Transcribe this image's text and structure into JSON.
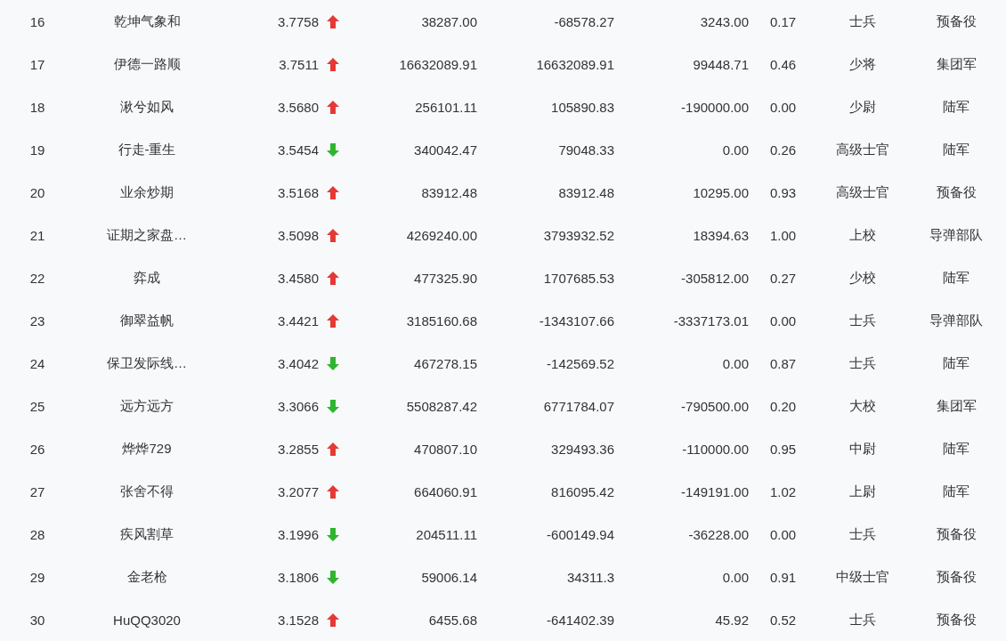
{
  "rows": [
    {
      "rank": "16",
      "name": "乾坤气象和",
      "score": "3.7758",
      "kind": "up",
      "column_4": "38287.00",
      "column_5": "-68578.27",
      "column_6": "3243.00",
      "column_7": "0.17",
      "rank_title": "士兵",
      "unit": "预备役"
    },
    {
      "rank": "17",
      "name": "伊德一路顺",
      "score": "3.7511",
      "kind": "up",
      "column_4": "16632089.91",
      "column_5": "16632089.91",
      "column_6": "99448.71",
      "column_7": "0.46",
      "rank_title": "少将",
      "unit": "集团军"
    },
    {
      "rank": "18",
      "name": "湫兮如风",
      "score": "3.5680",
      "kind": "up",
      "column_4": "256101.11",
      "column_5": "105890.83",
      "column_6": "-190000.00",
      "column_7": "0.00",
      "rank_title": "少尉",
      "unit": "陆军"
    },
    {
      "rank": "19",
      "name": "行走-重生",
      "score": "3.5454",
      "kind": "down",
      "column_4": "340042.47",
      "column_5": "79048.33",
      "column_6": "0.00",
      "column_7": "0.26",
      "rank_title": "高级士官",
      "unit": "陆军"
    },
    {
      "rank": "20",
      "name": "业余炒期",
      "score": "3.5168",
      "kind": "up",
      "column_4": "83912.48",
      "column_5": "83912.48",
      "column_6": "10295.00",
      "column_7": "0.93",
      "rank_title": "高级士官",
      "unit": "预备役"
    },
    {
      "rank": "21",
      "name": "证期之家盘…",
      "score": "3.5098",
      "kind": "up",
      "column_4": "4269240.00",
      "column_5": "3793932.52",
      "column_6": "18394.63",
      "column_7": "1.00",
      "rank_title": "上校",
      "unit": "导弹部队"
    },
    {
      "rank": "22",
      "name": "弈成",
      "score": "3.4580",
      "kind": "up",
      "column_4": "477325.90",
      "column_5": "1707685.53",
      "column_6": "-305812.00",
      "column_7": "0.27",
      "rank_title": "少校",
      "unit": "陆军"
    },
    {
      "rank": "23",
      "name": "御翠益帆",
      "score": "3.4421",
      "kind": "up",
      "column_4": "3185160.68",
      "column_5": "-1343107.66",
      "column_6": "-3337173.01",
      "column_7": "0.00",
      "rank_title": "士兵",
      "unit": "导弹部队"
    },
    {
      "rank": "24",
      "name": "保卫发际线…",
      "score": "3.4042",
      "kind": "down",
      "column_4": "467278.15",
      "column_5": "-142569.52",
      "column_6": "0.00",
      "column_7": "0.87",
      "rank_title": "士兵",
      "unit": "陆军"
    },
    {
      "rank": "25",
      "name": "远方远方",
      "score": "3.3066",
      "kind": "down",
      "column_4": "5508287.42",
      "column_5": "6771784.07",
      "column_6": "-790500.00",
      "column_7": "0.20",
      "rank_title": "大校",
      "unit": "集团军"
    },
    {
      "rank": "26",
      "name": "烨烨729",
      "score": "3.2855",
      "kind": "up",
      "column_4": "470807.10",
      "column_5": "329493.36",
      "column_6": "-110000.00",
      "column_7": "0.95",
      "rank_title": "中尉",
      "unit": "陆军"
    },
    {
      "rank": "27",
      "name": "张舍不得",
      "score": "3.2077",
      "kind": "up",
      "column_4": "664060.91",
      "column_5": "816095.42",
      "column_6": "-149191.00",
      "column_7": "1.02",
      "rank_title": "上尉",
      "unit": "陆军"
    },
    {
      "rank": "28",
      "name": "疾风割草",
      "score": "3.1996",
      "kind": "down",
      "column_4": "204511.11",
      "column_5": "-600149.94",
      "column_6": "-36228.00",
      "column_7": "0.00",
      "rank_title": "士兵",
      "unit": "预备役"
    },
    {
      "rank": "29",
      "name": "金老枪",
      "score": "3.1806",
      "kind": "down",
      "column_4": "59006.14",
      "column_5": "34311.3",
      "column_6": "0.00",
      "column_7": "0.91",
      "rank_title": "中级士官",
      "unit": "预备役"
    },
    {
      "rank": "30",
      "name": "HuQQ3020",
      "score": "3.1528",
      "kind": "up",
      "column_4": "6455.68",
      "column_5": "-641402.39",
      "column_6": "45.92",
      "column_7": "0.52",
      "rank_title": "士兵",
      "unit": "预备役"
    }
  ]
}
